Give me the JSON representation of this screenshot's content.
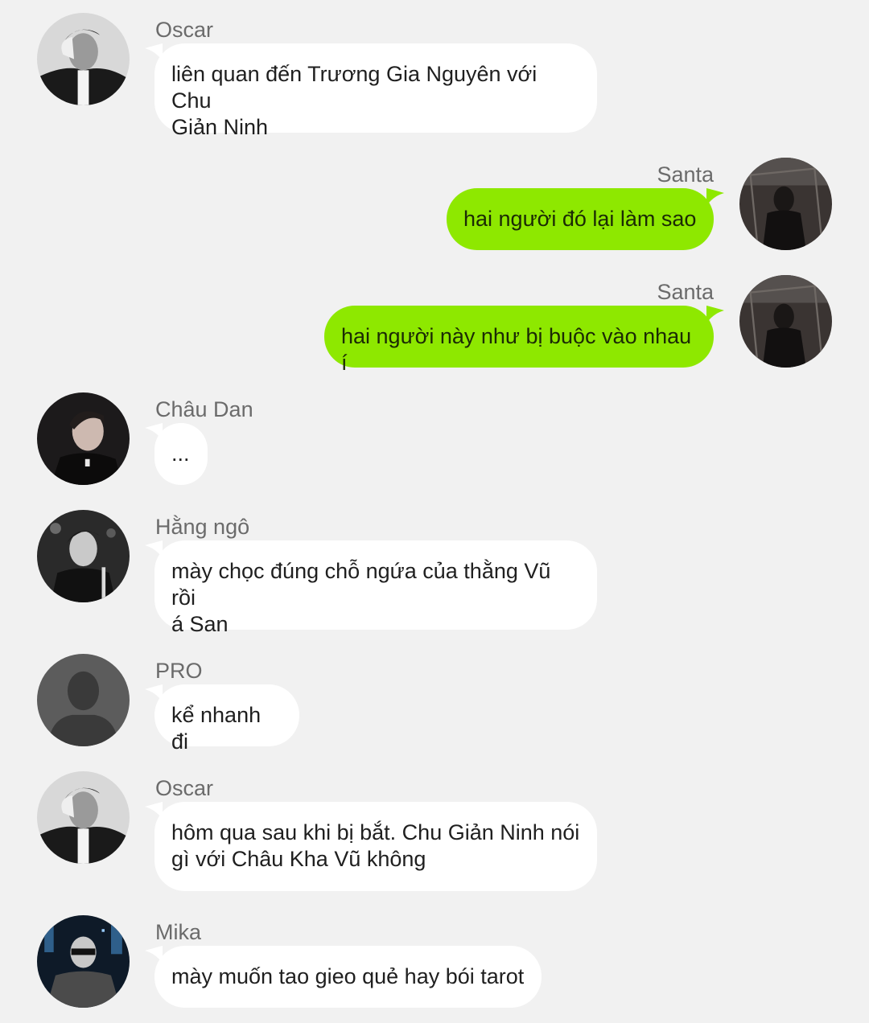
{
  "colors": {
    "background": "#f1f1f1",
    "incoming_bubble": "#ffffff",
    "outgoing_bubble": "#8ee800",
    "name_text": "#6b6b6b"
  },
  "messages": [
    {
      "sender": "Oscar",
      "text": "liên quan đến Trương Gia Nguyên với Chu\nGiản Ninh",
      "side": "left",
      "avatar": "oscar-avatar"
    },
    {
      "sender": "Santa",
      "text": "hai người đó lại làm sao",
      "side": "right",
      "avatar": "santa-avatar"
    },
    {
      "sender": "Santa",
      "text": "hai người này như bị buộc vào nhau í",
      "side": "right",
      "avatar": "santa-avatar"
    },
    {
      "sender": "Châu Dan",
      "text": "...",
      "side": "left",
      "avatar": "chau-dan-avatar"
    },
    {
      "sender": " Hằng ngô",
      "text": "mày chọc đúng chỗ ngứa của thằng Vũ rồi\ná San",
      "side": "left",
      "avatar": "hang-ngo-avatar"
    },
    {
      "sender": "PRO",
      "text": "kể nhanh đi",
      "side": "left",
      "avatar": "default-user-avatar"
    },
    {
      "sender": "Oscar",
      "text": "hôm qua sau khi bị bắt. Chu Giản Ninh nói\ngì với Châu Kha Vũ không",
      "side": "left",
      "avatar": "oscar-avatar"
    },
    {
      "sender": "Mika",
      "text": "mày muốn tao gieo quẻ hay bói tarot",
      "side": "left",
      "avatar": "mika-avatar"
    }
  ]
}
